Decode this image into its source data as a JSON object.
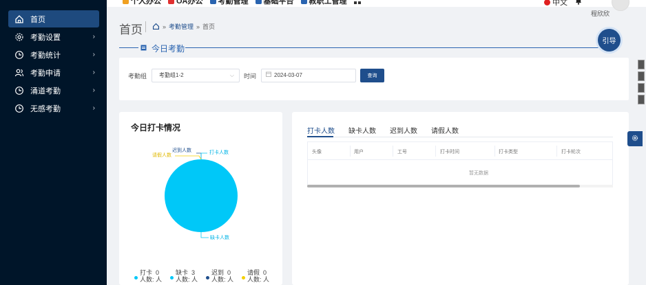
{
  "sidebar": {
    "items": [
      {
        "label": "首页",
        "icon": "home-icon",
        "active": true
      },
      {
        "label": "考勤设置",
        "icon": "gear-icon",
        "arrow": "›"
      },
      {
        "label": "考勤统计",
        "icon": "clock-icon",
        "arrow": "›"
      },
      {
        "label": "考勤申请",
        "icon": "users-icon",
        "arrow": "›"
      },
      {
        "label": "涌道考勤",
        "icon": "clock-icon",
        "arrow": "›"
      },
      {
        "label": "无感考勤",
        "icon": "clock-icon",
        "arrow": "›"
      }
    ]
  },
  "topbar": {
    "nav": [
      {
        "label": "个人办公",
        "color": "#f0a020"
      },
      {
        "label": "OA办公",
        "color": "#e03030"
      },
      {
        "label": "考勤管理",
        "color": "#2a64b0"
      },
      {
        "label": "基础平台",
        "color": "#2a64b0"
      },
      {
        "label": "教职工管理",
        "color": "#2a64b0"
      }
    ],
    "language": "中文",
    "username": "程欣欣"
  },
  "page": {
    "title": "首页",
    "breadcrumb": {
      "link": "考勤管理",
      "sep": "»",
      "current": "首页"
    },
    "section_title": "今日考勤",
    "guide_button": "引导"
  },
  "filter": {
    "group_label": "考勤组",
    "group_value": "考勤组1-2",
    "time_label": "时间",
    "date_value": "2024-03-07",
    "query_button": "查询"
  },
  "punch_card": {
    "title": "今日打卡情况",
    "pie_labels": {
      "late": "迟到人数",
      "punched": "打卡人数",
      "leave": "请假人数",
      "absent": "缺卡人数"
    },
    "legend": [
      {
        "label": "打卡",
        "value": "0",
        "unit": "人数: 人",
        "color": "#00c8f8"
      },
      {
        "label": "缺卡",
        "value": "3",
        "unit": "人数: 人",
        "color": "#00c8f8"
      },
      {
        "label": "迟到",
        "value": "0",
        "unit": "人数: 人",
        "color": "#1f4e8c"
      },
      {
        "label": "请假",
        "value": "0",
        "unit": "人数: 人",
        "color": "#f5d000"
      }
    ]
  },
  "list_card": {
    "tabs": [
      "打卡人数",
      "缺卡人数",
      "迟到人数",
      "请假人数"
    ],
    "active_tab": "打卡人数",
    "columns": [
      "头像",
      "用户",
      "工号",
      "打卡时间",
      "打卡类型",
      "打卡轮次"
    ],
    "empty_text": "暂无数据"
  },
  "colors": {
    "sidebar_bg": "#001529",
    "accent": "#1f4e8c",
    "pie": "#00c8f8"
  }
}
